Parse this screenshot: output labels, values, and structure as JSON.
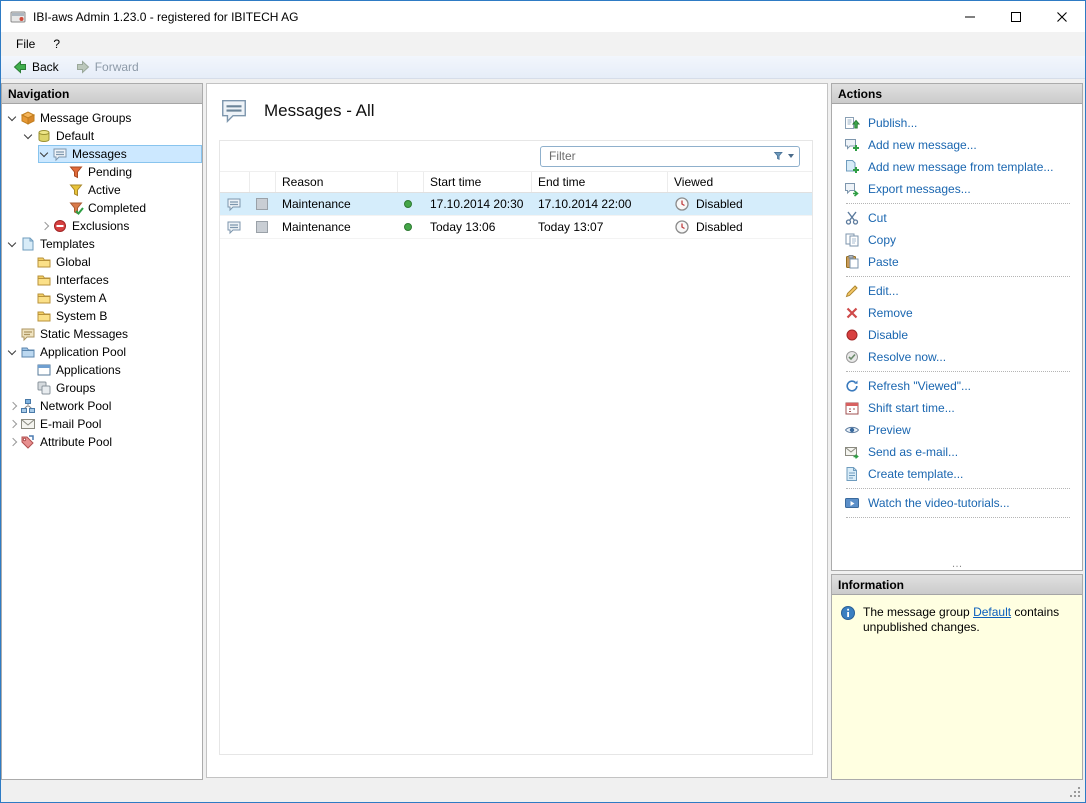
{
  "window": {
    "title": "IBI-aws Admin 1.23.0 - registered for IBITECH AG"
  },
  "menu": {
    "file": "File",
    "help": "?"
  },
  "toolbar": {
    "back": "Back",
    "forward": "Forward"
  },
  "navigation": {
    "header": "Navigation",
    "tree": [
      {
        "label": "Message Groups",
        "icon": "message-groups",
        "level": 0,
        "expander": "expanded",
        "selected": false
      },
      {
        "label": "Default",
        "icon": "message-group-default",
        "level": 1,
        "expander": "expanded",
        "selected": false
      },
      {
        "label": "Messages",
        "icon": "messages",
        "level": 2,
        "expander": "expanded",
        "selected": true
      },
      {
        "label": "Pending",
        "icon": "filter-pending",
        "level": 3,
        "expander": "none",
        "selected": false
      },
      {
        "label": "Active",
        "icon": "filter-active",
        "level": 3,
        "expander": "none",
        "selected": false
      },
      {
        "label": "Completed",
        "icon": "filter-completed",
        "level": 3,
        "expander": "none",
        "selected": false
      },
      {
        "label": "Exclusions",
        "icon": "exclusions",
        "level": 2,
        "expander": "collapsed",
        "selected": false
      },
      {
        "label": "Templates",
        "icon": "templates",
        "level": 0,
        "expander": "expanded",
        "selected": false
      },
      {
        "label": "Global",
        "icon": "folder",
        "level": 1,
        "expander": "none",
        "selected": false
      },
      {
        "label": "Interfaces",
        "icon": "folder",
        "level": 1,
        "expander": "none",
        "selected": false
      },
      {
        "label": "System A",
        "icon": "folder",
        "level": 1,
        "expander": "none",
        "selected": false
      },
      {
        "label": "System B",
        "icon": "folder",
        "level": 1,
        "expander": "none",
        "selected": false
      },
      {
        "label": "Static Messages",
        "icon": "static-messages",
        "level": 0,
        "expander": "none",
        "selected": false
      },
      {
        "label": "Application Pool",
        "icon": "application-pool",
        "level": 0,
        "expander": "expanded",
        "selected": false
      },
      {
        "label": "Applications",
        "icon": "applications",
        "level": 1,
        "expander": "none",
        "selected": false
      },
      {
        "label": "Groups",
        "icon": "groups",
        "level": 1,
        "expander": "none",
        "selected": false
      },
      {
        "label": "Network Pool",
        "icon": "network-pool",
        "level": 0,
        "expander": "collapsed",
        "selected": false
      },
      {
        "label": "E-mail Pool",
        "icon": "email-pool",
        "level": 0,
        "expander": "collapsed",
        "selected": false
      },
      {
        "label": "Attribute Pool",
        "icon": "attribute-pool",
        "level": 0,
        "expander": "collapsed",
        "selected": false
      }
    ]
  },
  "main": {
    "title": "Messages - All",
    "filter": {
      "placeholder": "Filter"
    },
    "table": {
      "columns": [
        {
          "key": "type",
          "label": ""
        },
        {
          "key": "color",
          "label": ""
        },
        {
          "key": "reason",
          "label": "Reason"
        },
        {
          "key": "status",
          "label": ""
        },
        {
          "key": "start",
          "label": "Start time"
        },
        {
          "key": "end",
          "label": "End time"
        },
        {
          "key": "viewed",
          "label": "Viewed"
        }
      ],
      "rows": [
        {
          "reason": "Maintenance",
          "start": "17.10.2014 20:30",
          "end": "17.10.2014 22:00",
          "viewed": "Disabled",
          "selected": true
        },
        {
          "reason": "Maintenance",
          "start": "Today 13:06",
          "end": "Today 13:07",
          "viewed": "Disabled",
          "selected": false
        }
      ]
    }
  },
  "actions": {
    "header": "Actions",
    "overflow": "…",
    "groups": [
      {
        "items": [
          {
            "label": "Publish...",
            "icon": "publish"
          },
          {
            "label": "Add new message...",
            "icon": "add-message"
          },
          {
            "label": "Add new message from template...",
            "icon": "add-message-template"
          },
          {
            "label": "Export messages...",
            "icon": "export-messages"
          }
        ]
      },
      {
        "items": [
          {
            "label": "Cut",
            "icon": "cut"
          },
          {
            "label": "Copy",
            "icon": "copy"
          },
          {
            "label": "Paste",
            "icon": "paste"
          }
        ]
      },
      {
        "items": [
          {
            "label": "Edit...",
            "icon": "edit"
          },
          {
            "label": "Remove",
            "icon": "remove"
          },
          {
            "label": "Disable",
            "icon": "disable"
          },
          {
            "label": "Resolve now...",
            "icon": "resolve"
          }
        ]
      },
      {
        "items": [
          {
            "label": "Refresh \"Viewed\"...",
            "icon": "refresh-viewed"
          },
          {
            "label": "Shift start time...",
            "icon": "shift-start-time"
          },
          {
            "label": "Preview",
            "icon": "preview"
          },
          {
            "label": "Send as e-mail...",
            "icon": "send-email"
          },
          {
            "label": "Create template...",
            "icon": "create-template"
          }
        ]
      },
      {
        "items": [
          {
            "label": "Watch the video-tutorials...",
            "icon": "video-tutorials"
          }
        ]
      }
    ]
  },
  "information": {
    "header": "Information",
    "text_before": "The message group ",
    "link_text": "Default",
    "text_after": " contains unpublished changes."
  }
}
